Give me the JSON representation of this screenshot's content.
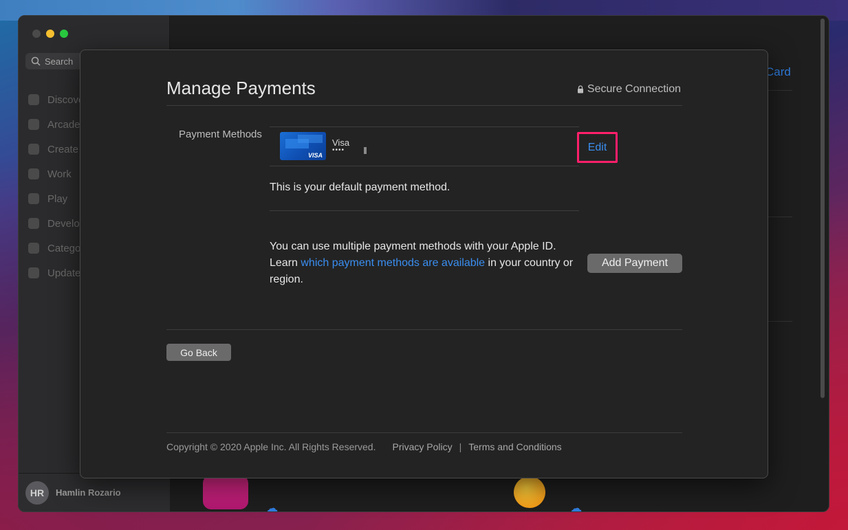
{
  "sidebar": {
    "search_label": "Search",
    "items": [
      {
        "label": "Discover"
      },
      {
        "label": "Arcade"
      },
      {
        "label": "Create"
      },
      {
        "label": "Work"
      },
      {
        "label": "Play"
      },
      {
        "label": "Develop"
      },
      {
        "label": "Categories"
      },
      {
        "label": "Updates"
      }
    ],
    "user": {
      "initials": "HR",
      "name": "Hamlin Rozario"
    }
  },
  "background": {
    "link_text": "Card",
    "cloud_glyph": "☁"
  },
  "sheet": {
    "title": "Manage Payments",
    "secure_label": "Secure Connection",
    "payment_methods_label": "Payment Methods",
    "card": {
      "brand_mark": "VISA",
      "name": "Visa",
      "masked_number": "••••"
    },
    "edit_label": "Edit",
    "default_note": "This is your default payment method.",
    "info_prefix": "You can use multiple payment methods with your Apple ID. Learn ",
    "info_link": "which payment methods are available",
    "info_suffix": " in your country or region.",
    "add_payment_label": "Add Payment",
    "go_back_label": "Go Back"
  },
  "footer": {
    "copyright": "Copyright © 2020 Apple Inc. All Rights Reserved.",
    "privacy": "Privacy Policy",
    "separator": "|",
    "terms": "Terms and Conditions"
  },
  "colors": {
    "accent": "#3a8ef0",
    "highlight_border": "#ff1f6b",
    "sheet_bg": "#232323"
  }
}
